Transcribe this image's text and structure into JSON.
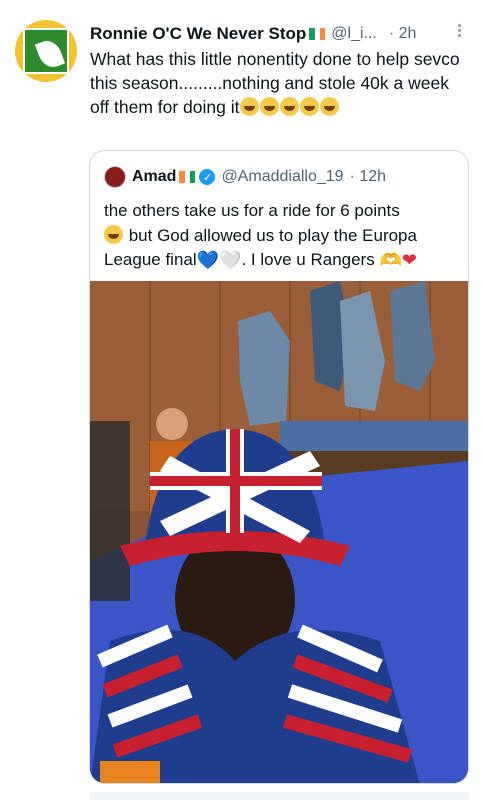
{
  "tweet": {
    "author_name": "Ronnie O'C We Never Stop",
    "handle": "@l_i...",
    "separator": "·",
    "time": "2h",
    "text": "What has this little  nonentity done to help sevco this season.........nothing and stole 40k a week off them for doing it",
    "emoji_count": 5
  },
  "quote": {
    "author_name": "Amad",
    "handle": "@Amaddiallo_19",
    "separator": "·",
    "time": "12h",
    "text_part1": "the others take us for a ride for 6 points",
    "text_part2": " but God allowed us to play the Europa League final",
    "text_part3": ". I love u Rangers ",
    "heart_blue": "💙",
    "heart_white": "🤍",
    "heart_red": "❤"
  },
  "icons": {
    "more": "more-options-icon",
    "verified": "verified-badge-icon",
    "flag": "ireland-flag-icon"
  },
  "colors": {
    "text": "#0f1419",
    "secondary": "#536471",
    "verified": "#1d9bf0",
    "border": "#cfd9de"
  }
}
